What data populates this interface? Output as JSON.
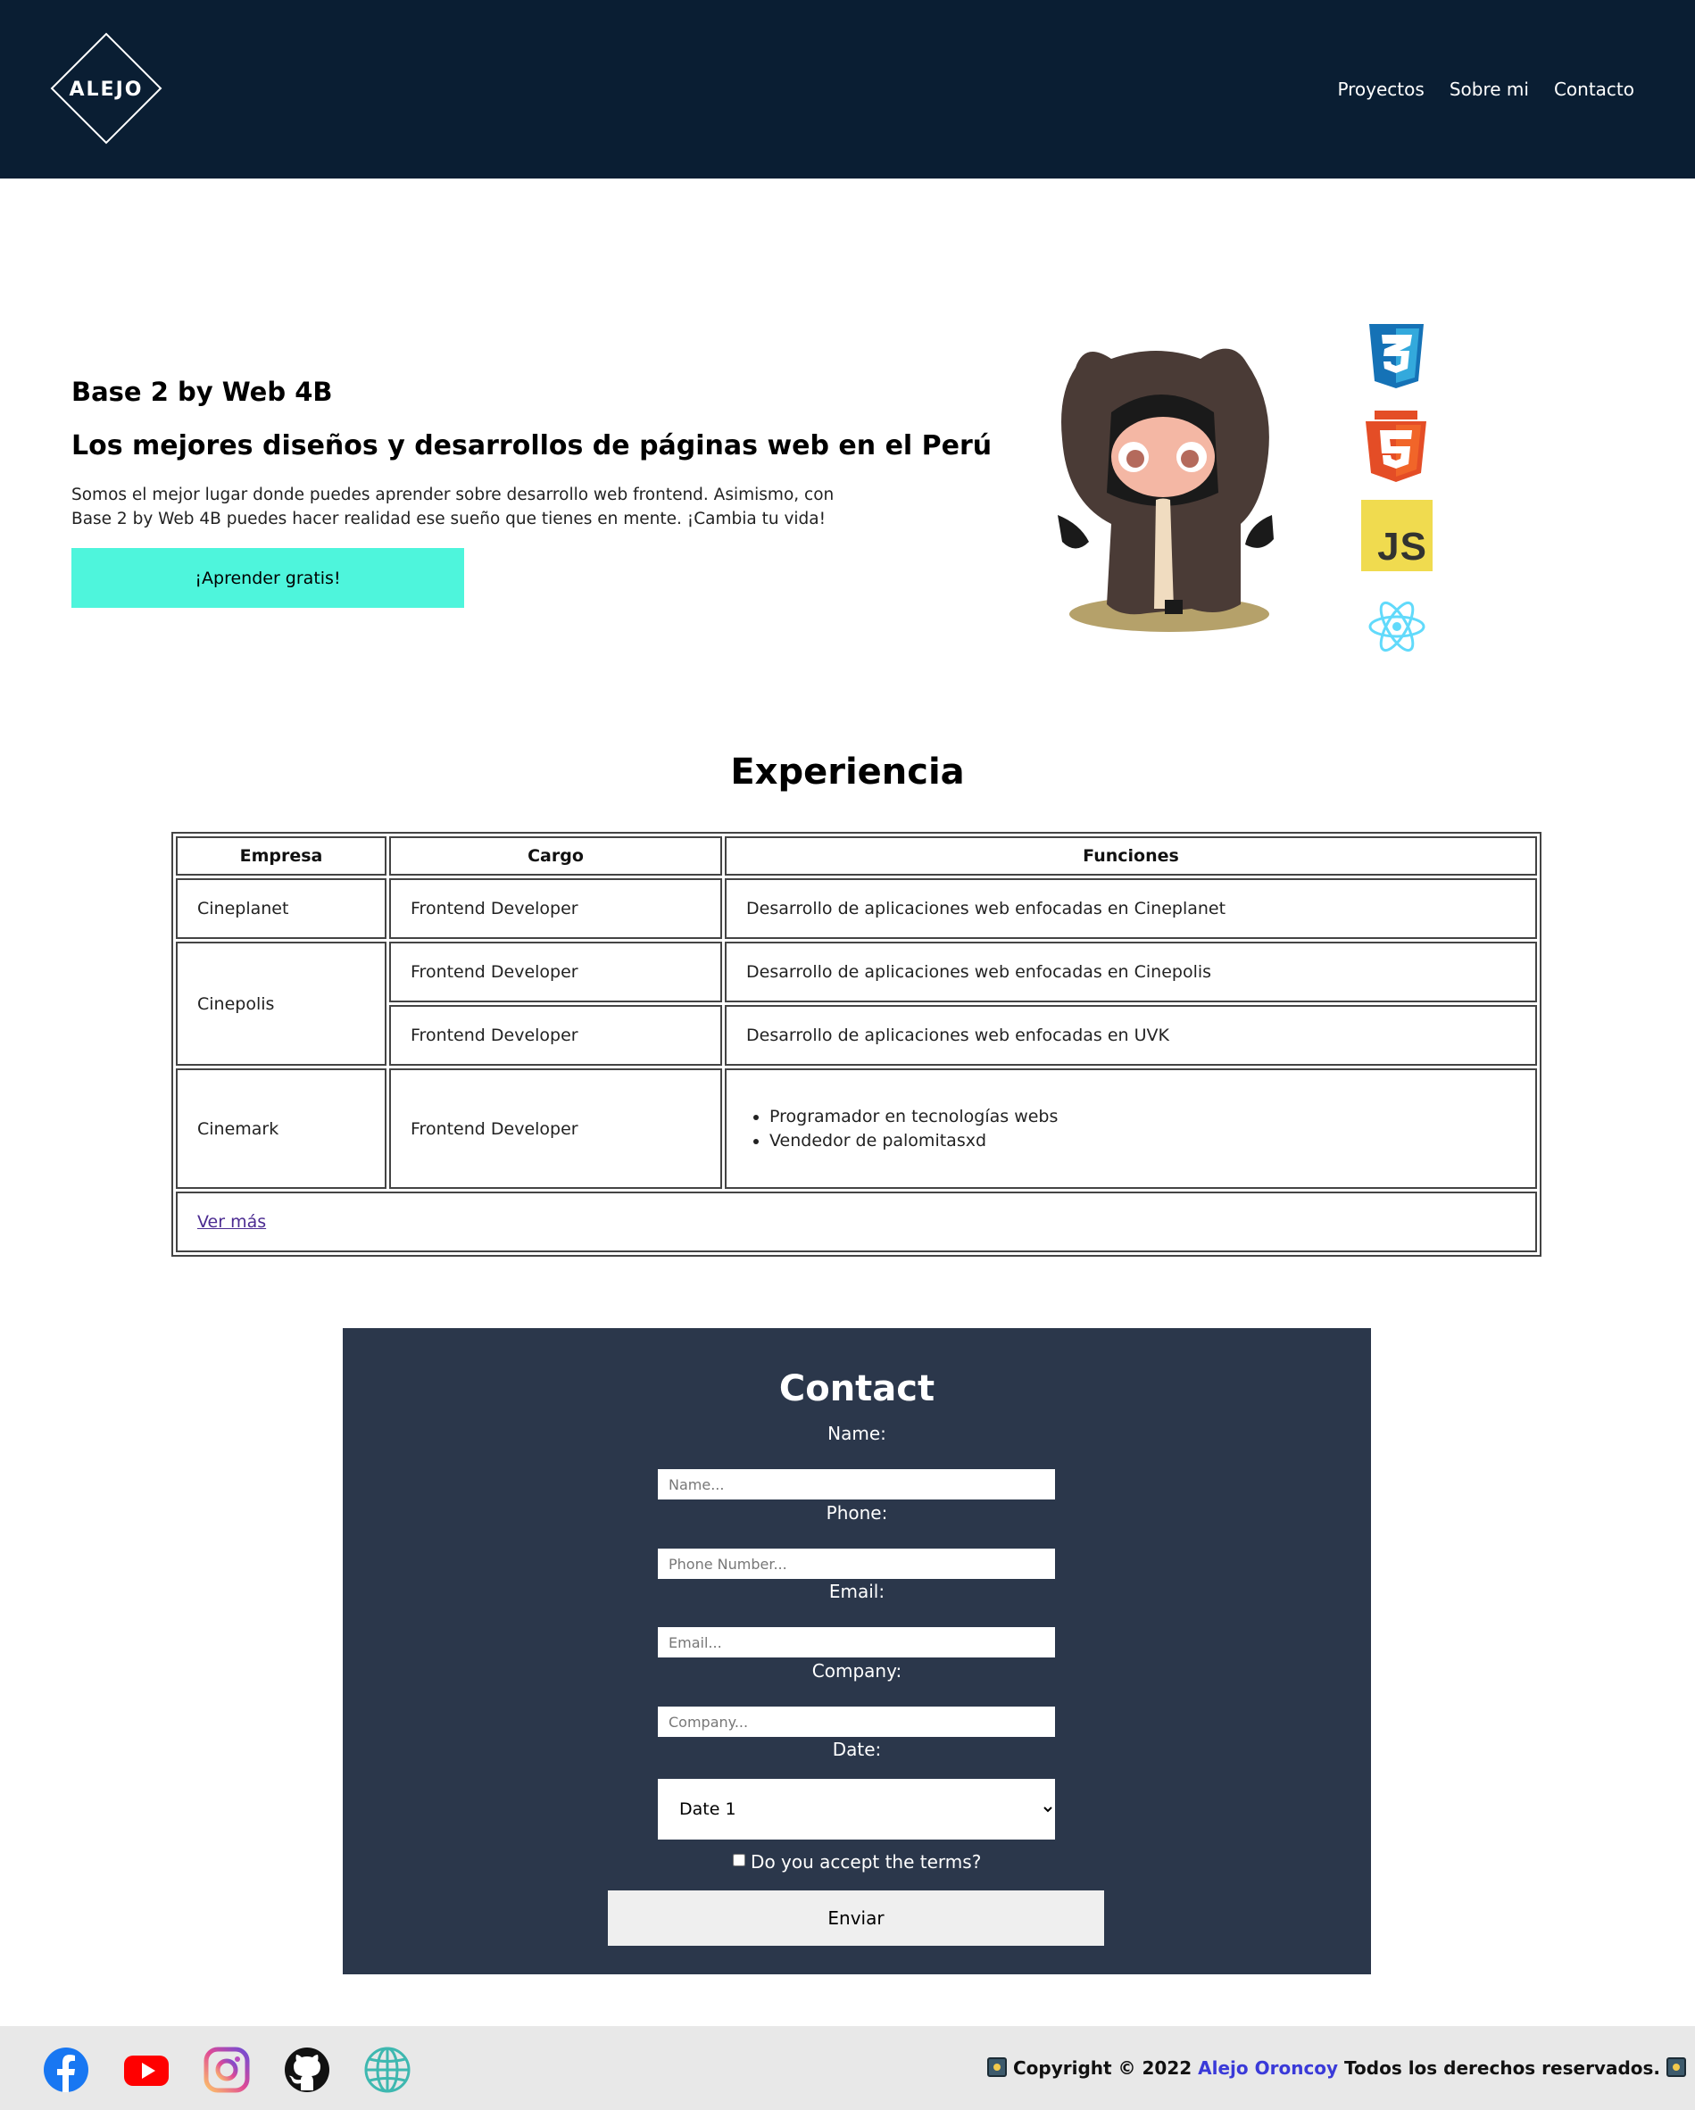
{
  "header": {
    "logo_text": "ALEJO",
    "nav": [
      "Proyectos",
      "Sobre mi",
      "Contacto"
    ]
  },
  "hero": {
    "title": "Base 2 by Web 4B",
    "subtitle": "Los mejores diseños y desarrollos de páginas web en el Perú",
    "text": "Somos el mejor lugar donde puedes aprender sobre desarrollo web frontend. Asimismo, con Base 2 by Web 4B puedes hacer realidad ese sueño que tienes en mente. ¡Cambia tu vida!",
    "button": "¡Aprender gratis!",
    "icons": [
      "github-octocat-icon",
      "css3-icon",
      "html5-icon",
      "javascript-icon",
      "react-icon"
    ],
    "js_label": "JS"
  },
  "experience": {
    "title": "Experiencia",
    "headers": [
      "Empresa",
      "Cargo",
      "Funciones"
    ],
    "rows": [
      {
        "company": "Cineplanet",
        "role": "Frontend Developer",
        "function": "Desarrollo de aplicaciones web enfocadas en Cineplanet"
      },
      {
        "company": "Cinepolis",
        "role": "Frontend Developer",
        "function": "Desarrollo de aplicaciones web enfocadas en Cinepolis"
      },
      {
        "role": "Frontend Developer",
        "function": "Desarrollo de aplicaciones web enfocadas en UVK"
      },
      {
        "company": "Cinemark",
        "role": "Frontend Developer",
        "functions": [
          "Programador en tecnologías webs",
          "Vendedor de palomitasxd"
        ]
      }
    ],
    "more_link": "Ver más"
  },
  "contact": {
    "title": "Contact",
    "fields": {
      "name": {
        "label": "Name:",
        "placeholder": "Name..."
      },
      "phone": {
        "label": "Phone:",
        "placeholder": "Phone Number..."
      },
      "email": {
        "label": "Email:",
        "placeholder": "Email..."
      },
      "company": {
        "label": "Company:",
        "placeholder": "Company..."
      },
      "date": {
        "label": "Date:",
        "selected": "Date 1"
      }
    },
    "terms": "Do you accept the terms?",
    "submit": "Enviar"
  },
  "footer": {
    "social": [
      "facebook-icon",
      "youtube-icon",
      "instagram-icon",
      "github-icon",
      "globe-icon"
    ],
    "copyright_prefix": "Copyright © 2022",
    "author": "Alejo Oroncoy",
    "copyright_suffix": "Todos los derechos reservados."
  },
  "colors": {
    "header_bg": "#0a1e33",
    "accent_button": "#4ef5dc",
    "contact_bg": "#2b374b",
    "footer_bg": "#e8e8e8",
    "author_link": "#3a3ad8"
  }
}
